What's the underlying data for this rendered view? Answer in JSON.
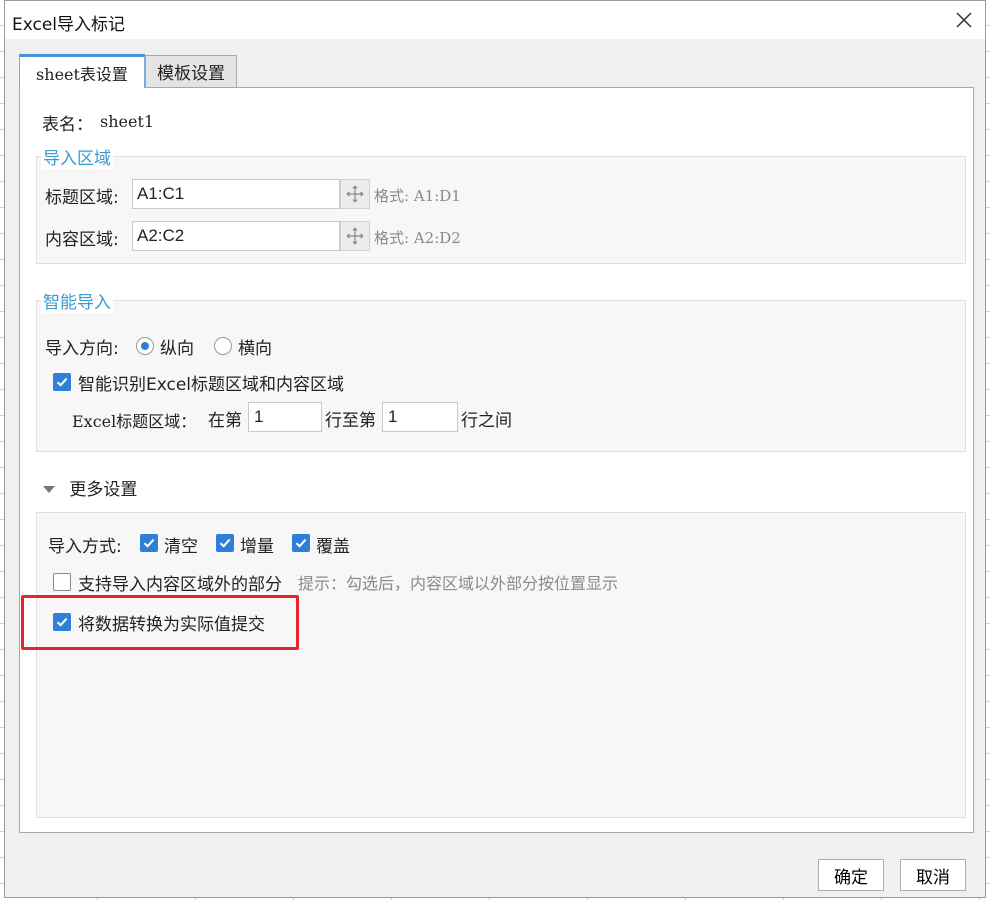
{
  "window": {
    "title": "Excel导入标记",
    "close_icon": "close-icon"
  },
  "tabs": [
    {
      "label": "sheet表设置",
      "active": true
    },
    {
      "label": "模板设置",
      "active": false
    }
  ],
  "sheet": {
    "label": "表名：",
    "name": "sheet1"
  },
  "import_region": {
    "legend": "导入区域",
    "title_region": {
      "label": "标题区域:",
      "value": "A1:C1",
      "format_hint": "格式: A1:D1"
    },
    "content_region": {
      "label": "内容区域:",
      "value": "A2:C2",
      "format_hint": "格式: A2:D2"
    }
  },
  "smart_import": {
    "legend": "智能导入",
    "direction_label": "导入方向:",
    "direction_options": [
      {
        "label": "纵向",
        "selected": true
      },
      {
        "label": "横向",
        "selected": false
      }
    ],
    "auto_detect": {
      "label": "智能识别Excel标题区域和内容区域",
      "checked": true
    },
    "title_rows": {
      "prefix": "Excel标题区域：",
      "from_label": "在第",
      "from_value": "1",
      "to_label": "行至第",
      "to_value": "1",
      "suffix": "行之间"
    }
  },
  "more_settings": {
    "label": "更多设置",
    "import_mode_label": "导入方式:",
    "import_modes": [
      {
        "label": "清空",
        "checked": true
      },
      {
        "label": "增量",
        "checked": true
      },
      {
        "label": "覆盖",
        "checked": true
      }
    ],
    "outside_content": {
      "label": "支持导入内容区域外的部分",
      "checked": false,
      "hint": "提示：勾选后，内容区域以外部分按位置显示"
    },
    "convert_actual": {
      "label": "将数据转换为实际值提交",
      "checked": true
    }
  },
  "footer": {
    "ok_label": "确定",
    "cancel_label": "取消"
  },
  "colors": {
    "accent": "#2f7fd7",
    "legend": "#3a9bd0",
    "highlight": "#e8242a"
  }
}
